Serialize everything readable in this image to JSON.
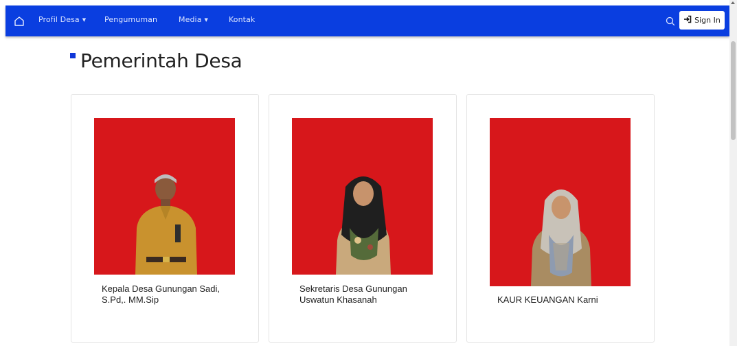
{
  "navbar": {
    "items": [
      {
        "label": "Profil Desa",
        "dropdown": true
      },
      {
        "label": "Pengumuman",
        "dropdown": false
      },
      {
        "label": "Media",
        "dropdown": true
      },
      {
        "label": "Kontak",
        "dropdown": false
      }
    ],
    "signin_label": "Sign In",
    "icons": {
      "home": "home-icon",
      "search": "search-icon",
      "signin": "sign-in-icon"
    },
    "color": "#0a3ee0"
  },
  "page": {
    "title": "Pemerintah Desa",
    "accent": "#1037d8"
  },
  "officials": [
    {
      "caption_line1": "Kepala Desa Gunungan Sadi,",
      "caption_line2": "S.Pd,. MM.Sip"
    },
    {
      "caption_line1": "Sekretaris Desa Gunungan",
      "caption_line2": "Uswatun Khasanah"
    },
    {
      "caption_line1": "KAUR KEUANGAN Karni",
      "caption_line2": ""
    }
  ],
  "photo_background": "#d7171b"
}
